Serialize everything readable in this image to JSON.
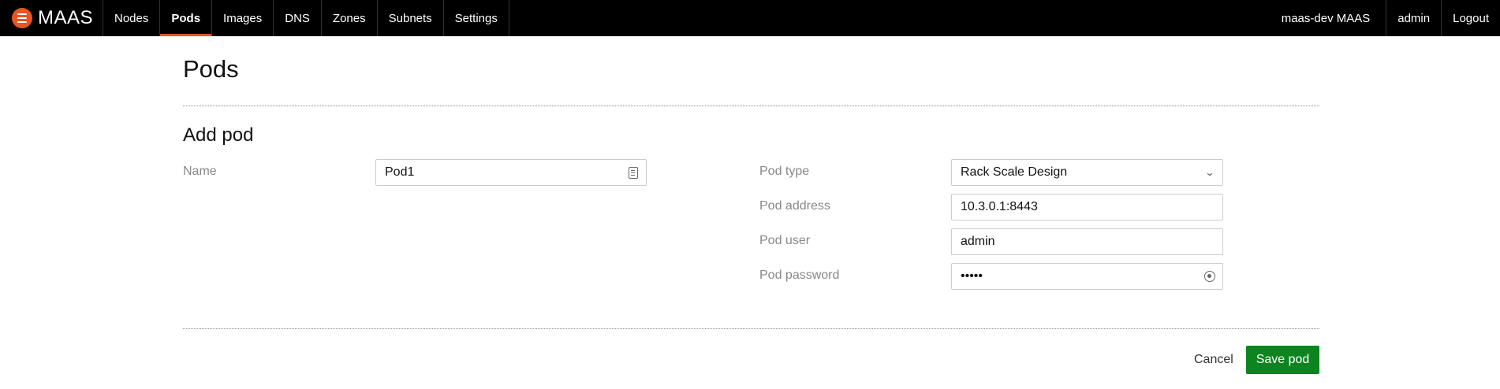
{
  "navbar": {
    "brand": "MAAS",
    "items": [
      {
        "label": "Nodes",
        "active": false
      },
      {
        "label": "Pods",
        "active": true
      },
      {
        "label": "Images",
        "active": false
      },
      {
        "label": "DNS",
        "active": false
      },
      {
        "label": "Zones",
        "active": false
      },
      {
        "label": "Subnets",
        "active": false
      },
      {
        "label": "Settings",
        "active": false
      }
    ],
    "site_name": "maas-dev MAAS",
    "user": "admin",
    "logout": "Logout",
    "accent_color": "#e95420"
  },
  "page": {
    "title": "Pods",
    "section_title": "Add pod"
  },
  "form": {
    "name": {
      "label": "Name",
      "value": "Pod1",
      "icon": "id-card-icon"
    },
    "pod_type": {
      "label": "Pod type",
      "value": "Rack Scale Design",
      "icon": "chevron-down-icon"
    },
    "pod_address": {
      "label": "Pod address",
      "value": "10.3.0.1:8443"
    },
    "pod_user": {
      "label": "Pod user",
      "value": "admin"
    },
    "pod_password": {
      "label": "Pod password",
      "value": "•••••",
      "icon": "key-icon"
    }
  },
  "actions": {
    "cancel": "Cancel",
    "save": "Save pod",
    "save_color": "#0e8420"
  }
}
